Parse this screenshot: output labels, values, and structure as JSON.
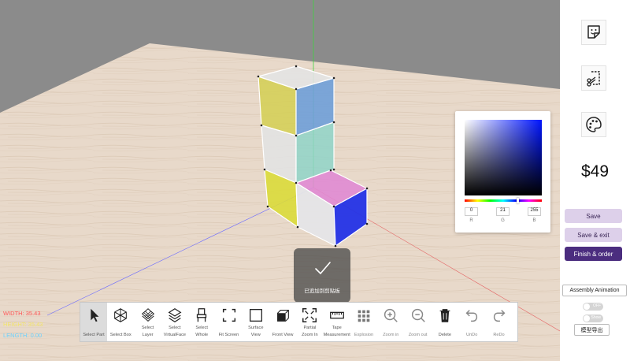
{
  "dimensions": {
    "width_label": "WIDTH: 35.43",
    "height_label": "HEIGHT: 35.43",
    "length_label": "LENGTH: 0.00",
    "width_color": "#ff5a5a",
    "height_color": "#f3e56b",
    "length_color": "#6ad2ff"
  },
  "toolbar": {
    "tools": [
      {
        "name": "Select Part",
        "lines": [
          "",
          "Select Part"
        ],
        "icon": "cursor-icon",
        "active": true
      },
      {
        "name": "Select Box",
        "lines": [
          "",
          "Select Box"
        ],
        "icon": "cube-wireframe-icon"
      },
      {
        "name": "Select Layer",
        "lines": [
          "Select",
          "Layer"
        ],
        "icon": "layer-grid-icon"
      },
      {
        "name": "Select VirtualFace",
        "lines": [
          "Select",
          "VirtualFace"
        ],
        "icon": "layers-icon"
      },
      {
        "name": "Select Whole",
        "lines": [
          "Select",
          "Whole"
        ],
        "icon": "chair-icon"
      },
      {
        "name": "Fit Screen",
        "lines": [
          "",
          "Fit Screen"
        ],
        "icon": "fit-screen-icon"
      },
      {
        "name": "Surface View",
        "lines": [
          "Surface",
          "View"
        ],
        "icon": "square-icon"
      },
      {
        "name": "Front View",
        "lines": [
          "",
          "Front View"
        ],
        "icon": "front-view-icon"
      },
      {
        "name": "Partial Zoom In",
        "lines": [
          "Partial",
          "Zoom In"
        ],
        "icon": "partial-zoom-icon"
      },
      {
        "name": "Tape Measurement",
        "lines": [
          "Tape",
          "Measurement"
        ],
        "icon": "ruler-icon"
      },
      {
        "name": "Explosion",
        "lines": [
          "",
          "Explosion"
        ],
        "icon": "explosion-grid-icon",
        "dim": true
      },
      {
        "name": "Zoom in",
        "lines": [
          "",
          "Zoom in"
        ],
        "icon": "zoom-in-icon",
        "dim": true
      },
      {
        "name": "Zoom out",
        "lines": [
          "",
          "Zoom out"
        ],
        "icon": "zoom-out-icon",
        "dim": true
      },
      {
        "name": "Delete",
        "lines": [
          "",
          "Delete"
        ],
        "icon": "trash-icon"
      },
      {
        "name": "UnDo",
        "lines": [
          "",
          "UnDo"
        ],
        "icon": "undo-icon",
        "dim": true
      },
      {
        "name": "ReDo",
        "lines": [
          "",
          "ReDo"
        ],
        "icon": "redo-icon",
        "dim": true
      }
    ]
  },
  "toast": {
    "text": "已追加到剪贴板",
    "icon": "check-icon"
  },
  "color_picker": {
    "r": "0",
    "g": "21",
    "b": "255",
    "r_label": "R",
    "g_label": "G",
    "b_label": "B",
    "hue_color": "#0015ff"
  },
  "side_panel": {
    "icons": [
      "sticker-icon",
      "screenshot-cut-icon",
      "palette-icon"
    ],
    "price": "$49",
    "save": "Save",
    "save_exit": "Save & exit",
    "finish_order": "Finish & order",
    "assembly_animation": "Assembly Animation",
    "toggle1_label": "OFF",
    "toggle2_label": "Show",
    "export": "模型导出"
  },
  "colors": {
    "accent": "#4b2d7f",
    "accent_light": "#ddd0ea",
    "floor": "#e7d8c9"
  }
}
